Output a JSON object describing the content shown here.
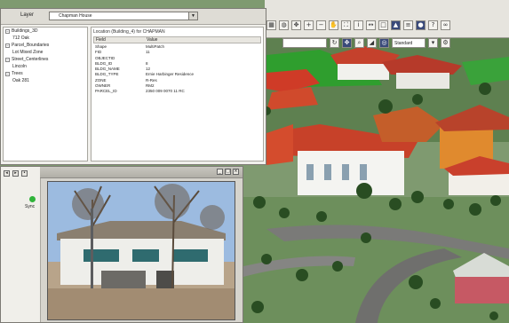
{
  "layer_label": "Layer",
  "layer_value": "Chapman House",
  "tree": [
    {
      "label": "Buildings_3D",
      "indent": 0,
      "expanded": true
    },
    {
      "label": "712 Oak",
      "indent": 1,
      "expanded": false
    },
    {
      "label": "Parcel_Boundaries",
      "indent": 0,
      "expanded": true
    },
    {
      "label": "Lot Mixed Zone",
      "indent": 1,
      "expanded": false
    },
    {
      "label": "Street_Centerlines",
      "indent": 0,
      "expanded": true
    },
    {
      "label": "Lincoln",
      "indent": 1,
      "expanded": false
    },
    {
      "label": "Trees",
      "indent": 0,
      "expanded": true
    },
    {
      "label": "Oak 281",
      "indent": 1,
      "expanded": false
    }
  ],
  "attr_title": "Location (Building_4) for CHAPMAN",
  "attr_columns": [
    "Field",
    "Value"
  ],
  "attr_rows": [
    [
      "Shape",
      "MultiPatch"
    ],
    [
      "FID",
      "11"
    ],
    [
      "OBJECTID",
      ""
    ],
    [
      "BLDG_ID",
      "8"
    ],
    [
      "BLDG_NAME",
      "12"
    ],
    [
      "BLDG_TYPE",
      "Ernie Harbinger Residence"
    ],
    [
      "ZONE",
      "R-Res"
    ],
    [
      "OWNER",
      "RM2"
    ],
    [
      "PARCEL_ID",
      "2350 009 0070 11 RC"
    ]
  ],
  "toolbar": {
    "row1_icons": [
      "grid-icon",
      "globe-icon",
      "navigate-icon",
      "zoom-in-icon",
      "zoom-out-icon",
      "pan-icon",
      "full-extent-icon",
      "identify-icon",
      "measure-icon",
      "select-icon",
      "fly-icon",
      "layers-icon",
      "info-icon",
      "help-icon",
      "binoculars-icon"
    ],
    "row2_icons": [
      "rotate-icon",
      "navigate-icon",
      "zoom-icon",
      "tilt-icon",
      "target-icon"
    ],
    "combo_label": "Standard"
  },
  "side_label": "Sync",
  "colors": {
    "window_bg": "#f1f0ec",
    "toolbar_bg": "#e6e4de",
    "accent_green": "#2fb43a",
    "roof_red": "#c8412b",
    "grass": "#5f8a4a"
  }
}
